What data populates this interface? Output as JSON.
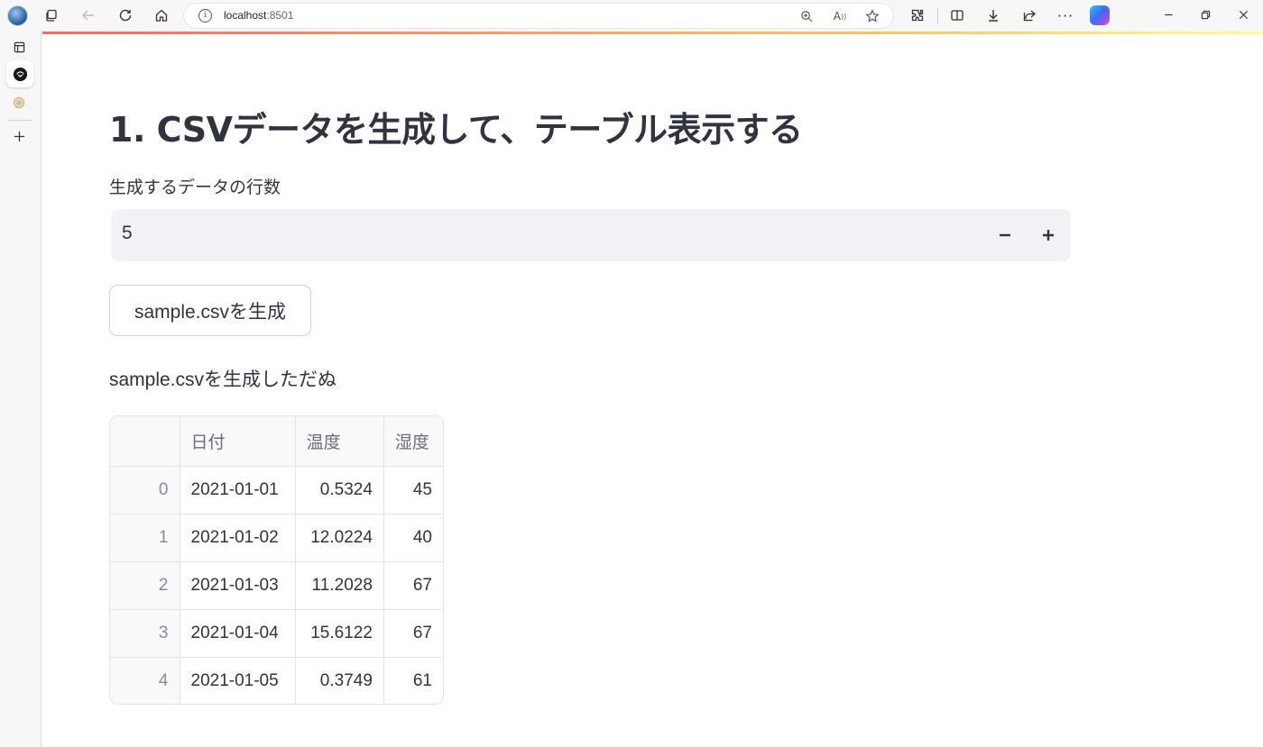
{
  "browser": {
    "url_host": "localhost",
    "url_port": ":8501"
  },
  "app": {
    "title": "1. CSVデータを生成して、テーブル表示する",
    "rows_label": "生成するデータの行数",
    "rows_value": "5",
    "decrement_label": "−",
    "increment_label": "+",
    "generate_button": "sample.csvを生成",
    "status_message": "sample.csvを生成しただぬ"
  },
  "table": {
    "columns": [
      "",
      "日付",
      "温度",
      "湿度"
    ],
    "rows": [
      {
        "index": "0",
        "date": "2021-01-01",
        "temp": "0.5324",
        "humidity": "45"
      },
      {
        "index": "1",
        "date": "2021-01-02",
        "temp": "12.0224",
        "humidity": "40"
      },
      {
        "index": "2",
        "date": "2021-01-03",
        "temp": "11.2028",
        "humidity": "67"
      },
      {
        "index": "3",
        "date": "2021-01-04",
        "temp": "15.6122",
        "humidity": "67"
      },
      {
        "index": "4",
        "date": "2021-01-05",
        "temp": "0.3749",
        "humidity": "61"
      }
    ]
  },
  "colors": {
    "accent_bar_start": "#ff4b4b",
    "accent_bar_end": "#fffd80",
    "input_bg": "#f0f2f6",
    "text": "#31333f"
  }
}
